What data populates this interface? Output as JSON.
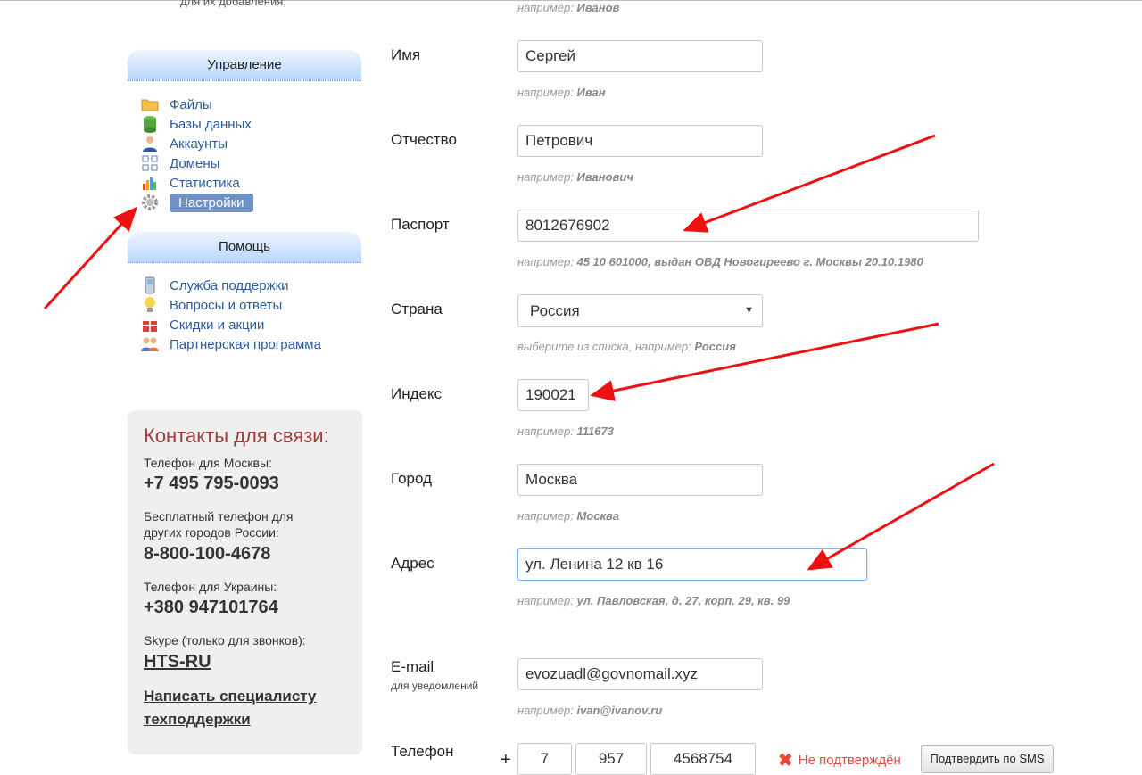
{
  "top_cut_text": "для их добавления:",
  "top_hint": {
    "prefix": "например:",
    "value": "Иванов"
  },
  "management": {
    "title": "Управление",
    "items": [
      {
        "label": "Файлы",
        "icon": "folder-icon"
      },
      {
        "label": "Базы данных",
        "icon": "database-icon"
      },
      {
        "label": "Аккаунты",
        "icon": "user-icon"
      },
      {
        "label": "Домены",
        "icon": "domains-icon"
      },
      {
        "label": "Статистика",
        "icon": "chart-icon"
      },
      {
        "label": "Настройки",
        "icon": "gear-icon",
        "active": true
      }
    ]
  },
  "help": {
    "title": "Помощь",
    "items": [
      {
        "label": "Служба поддержки",
        "icon": "phone-icon"
      },
      {
        "label": "Вопросы и ответы",
        "icon": "lightbulb-icon"
      },
      {
        "label": "Скидки и акции",
        "icon": "gift-icon"
      },
      {
        "label": "Партнерская программа",
        "icon": "partners-icon"
      }
    ]
  },
  "contacts": {
    "title": "Контакты для связи:",
    "moscow_label": "Телефон для Москвы:",
    "moscow_phone": "+7 495 795-0093",
    "free_label_1": "Бесплатный телефон для",
    "free_label_2": "других городов России:",
    "free_phone": "8-800-100-4678",
    "ukraine_label": "Телефон для Украины:",
    "ukraine_phone": "+380 947101764",
    "skype_label": "Skype (только для звонков):",
    "skype": "HTS-RU",
    "write_1": "Написать специалисту",
    "write_2": "техподдержки"
  },
  "form": {
    "first_name": {
      "label": "Имя",
      "value": "Сергей",
      "hint_prefix": "например:",
      "hint_value": "Иван"
    },
    "patronymic": {
      "label": "Отчество",
      "value": "Петрович",
      "hint_prefix": "например:",
      "hint_value": "Иванович"
    },
    "passport": {
      "label": "Паспорт",
      "value": "8012676902",
      "hint_prefix": "например:",
      "hint_value": "45 10 601000, выдан ОВД Новогиреево г. Москвы 20.10.1980"
    },
    "country": {
      "label": "Страна",
      "value": "Россия",
      "hint_prefix": "выберите из списка, например:",
      "hint_value": "Россия"
    },
    "zip": {
      "label": "Индекс",
      "value": "190021",
      "hint_prefix": "например:",
      "hint_value": "111673"
    },
    "city": {
      "label": "Город",
      "value": "Москва",
      "hint_prefix": "например:",
      "hint_value": "Москва"
    },
    "address": {
      "label": "Адрес",
      "value": "ул. Ленина 12 кв 16",
      "hint_prefix": "например:",
      "hint_value": "ул. Павловская, д. 27, корп. 29, кв. 99"
    },
    "email": {
      "label": "E-mail",
      "sublabel": "для уведомлений",
      "value": "evozuadl@govnomail.xyz",
      "hint_prefix": "например:",
      "hint_value": "ivan@ivanov.ru"
    },
    "phone": {
      "label": "Телефон",
      "plus": "+",
      "country_code": "7",
      "area_code": "957",
      "number": "4568754",
      "status": "Не подтверждён",
      "confirm_button": "Подтвердить по SMS"
    }
  },
  "colors": {
    "link": "#2a5b9e",
    "active_bg": "#6f91c4",
    "contacts_title": "#9b3b3b",
    "error": "#e24a3a",
    "annotation_arrow": "#ee1111"
  }
}
